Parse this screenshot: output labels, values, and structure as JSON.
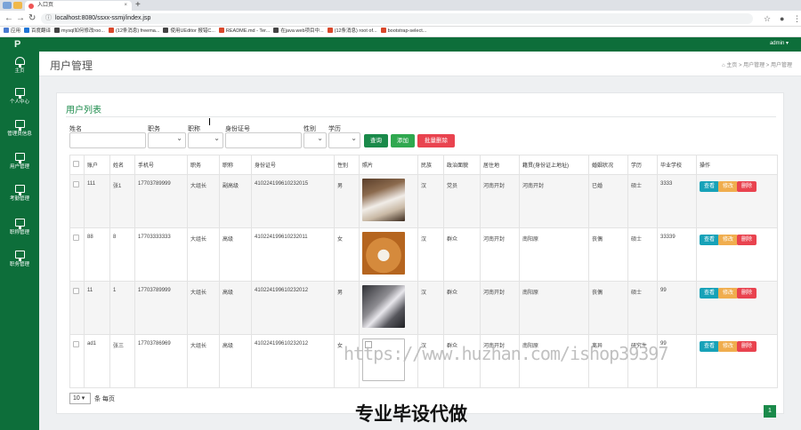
{
  "browser": {
    "tab_title": "入口页",
    "url": "localhost:8080/ssxx-ssmj/index.jsp",
    "bookmarks": [
      "应用",
      "百度翻译",
      "mysql如何修改roo...",
      "(12条消息) freema...",
      "使用UEditor 报错C...",
      "README.md - Ter...",
      "在java web项目中...",
      "(12条消息) root of...",
      "bootstrap-select..."
    ],
    "bookmark_colors": [
      "#4a7bd0",
      "#1f75d6",
      "#444",
      "#d9482b",
      "#444",
      "#d9482b",
      "#444",
      "#d9482b",
      "#d9482b"
    ]
  },
  "topbar": {
    "user": "admin ▾"
  },
  "sidebar": {
    "logo": "P",
    "items": [
      {
        "label": "主页",
        "icon": "dashboard-icon"
      },
      {
        "label": "个人中心",
        "icon": "monitor-icon"
      },
      {
        "label": "管理员信息",
        "icon": "monitor-icon"
      },
      {
        "label": "用户管理",
        "icon": "monitor-icon"
      },
      {
        "label": "考勤管理",
        "icon": "monitor-icon"
      },
      {
        "label": "职称管理",
        "icon": "monitor-icon"
      },
      {
        "label": "职务管理",
        "icon": "monitor-icon"
      }
    ]
  },
  "page": {
    "title": "用户管理",
    "breadcrumb": [
      "主页",
      "用户管理",
      "用户管理"
    ]
  },
  "panel": {
    "title": "用户列表"
  },
  "filters": {
    "name": "姓名",
    "duty": "职务",
    "rank": "职称",
    "idcard": "身份证号",
    "gender": "性别",
    "edu": "学历",
    "query": "查询",
    "add": "添加",
    "batch_delete": "批量删除"
  },
  "table": {
    "headers": [
      "",
      "账户",
      "姓名",
      "手机号",
      "职务",
      "职称",
      "身份证号",
      "性别",
      "照片",
      "民族",
      "政治面貌",
      "居住地",
      "籍贯(身份证上地址)",
      "婚姻状况",
      "学历",
      "毕业学校",
      "操作"
    ],
    "rows": [
      {
        "account": "111",
        "name": "张1",
        "phone": "17703789999",
        "duty": "大组长",
        "rank": "副高级",
        "idcard": "410224199610232015",
        "gender": "男",
        "photo": "cat",
        "nation": "汉",
        "politics": "党员",
        "residence": "河南开封",
        "native": "河南开封",
        "marital": "已婚",
        "edu": "硕士",
        "school": "3333"
      },
      {
        "account": "88",
        "name": "8",
        "phone": "17703333333",
        "duty": "大组长",
        "rank": "高级",
        "idcard": "410224199610232011",
        "gender": "女",
        "photo": "shiba",
        "nation": "汉",
        "politics": "群众",
        "residence": "河南开封",
        "native": "南阳原",
        "marital": "丧偶",
        "edu": "硕士",
        "school": "33339"
      },
      {
        "account": "11",
        "name": "1",
        "phone": "17703789999",
        "duty": "大组长",
        "rank": "高级",
        "idcard": "410224199610232012",
        "gender": "男",
        "photo": "husky",
        "nation": "汉",
        "politics": "群众",
        "residence": "河南开封",
        "native": "南阳原",
        "marital": "丧偶",
        "edu": "硕士",
        "school": "99"
      },
      {
        "account": "ad1",
        "name": "张三",
        "phone": "17703786969",
        "duty": "大组长",
        "rank": "高级",
        "idcard": "410224199610232012",
        "gender": "女",
        "photo": "broken",
        "nation": "汉",
        "politics": "群众",
        "residence": "河南开封",
        "native": "南阳原",
        "marital": "离异",
        "edu": "研究生",
        "school": "99"
      }
    ],
    "actions": {
      "view": "查看",
      "edit": "修改",
      "delete": "删除"
    }
  },
  "footer": {
    "page_size": "10",
    "per_page": "条 每页",
    "current_page": "1"
  },
  "watermark": {
    "url": "https://www.huzhan.com/ishop39397",
    "slogan": "专业毕设代做"
  },
  "colors": {
    "brand": "#0d6e3a",
    "accent": "#1a8a4a",
    "view": "#17a2b8",
    "edit": "#f0ad4e",
    "delete": "#e9434f"
  }
}
